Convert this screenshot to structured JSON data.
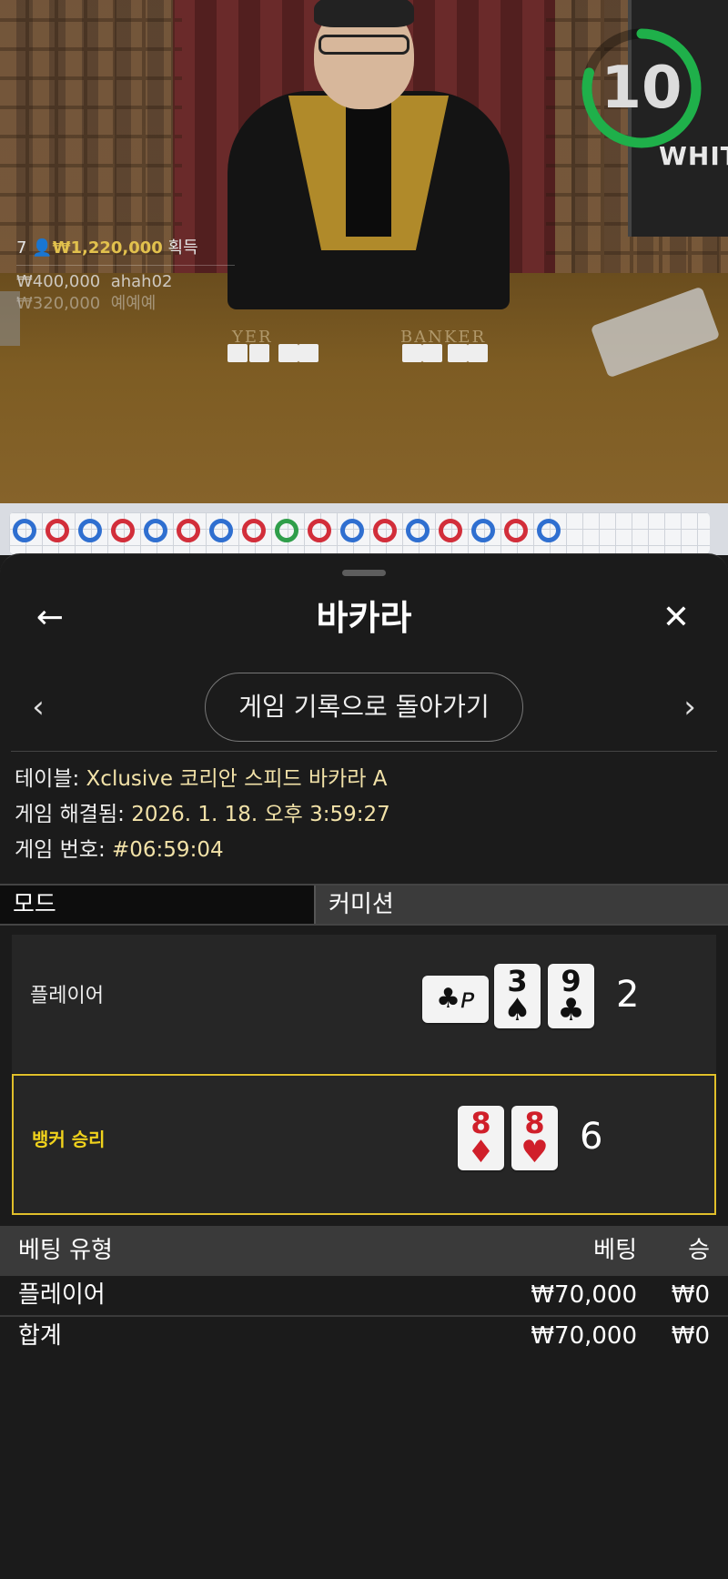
{
  "video": {
    "timer": "10",
    "monitor_text": "WHITE",
    "felt_labels": [
      "YER",
      "BANKER"
    ],
    "winners": {
      "count": "7",
      "total": "₩1,220,000",
      "total_suffix": "획득",
      "entries": [
        {
          "amount": "₩400,000",
          "name": "ahah02"
        },
        {
          "amount": "₩320,000",
          "name": "예예예"
        }
      ]
    }
  },
  "roadmap": {
    "beads": [
      "P",
      "B",
      "P",
      "B",
      "P",
      "B",
      "P",
      "B",
      "T",
      "B",
      "P",
      "B",
      "P",
      "B",
      "P",
      "B",
      "P"
    ]
  },
  "sheet": {
    "title": "바카라",
    "back_icon": "←",
    "close_icon": "✕",
    "prev_icon": "‹",
    "next_icon": "›",
    "back_to_history": "게임 기록으로 돌아가기",
    "info": {
      "table_label": "테이블:",
      "table_value": "Xclusive 코리안 스피드 바카라 A",
      "resolved_label": "게임 해결됨:",
      "resolved_value": "2026. 1. 18. 오후 3:59:27",
      "number_label": "게임 번호:",
      "number_value": "#06:59:04"
    },
    "mode_label": "모드",
    "mode_value": "커미션",
    "player": {
      "label": "플레이어",
      "score": "2",
      "third_card": {
        "rank": "♣",
        "suit": "ᴘ"
      },
      "cards": [
        {
          "rank": "3",
          "suit": "♠",
          "color": "#111111"
        },
        {
          "rank": "9",
          "suit": "♣",
          "color": "#111111"
        }
      ]
    },
    "banker": {
      "label": "뱅커 승리",
      "score": "6",
      "cards": [
        {
          "rank": "8",
          "suit": "♦",
          "color": "#d01f2a"
        },
        {
          "rank": "8",
          "suit": "♥",
          "color": "#d01f2a"
        }
      ]
    },
    "bets": {
      "headers": {
        "type": "베팅 유형",
        "bet": "베팅",
        "win": "승"
      },
      "rows": [
        {
          "type": "플레이어",
          "bet": "₩70,000",
          "win": "₩0"
        }
      ],
      "total": {
        "type": "합계",
        "bet": "₩70,000",
        "win": "₩0"
      }
    },
    "accent_color": "#e0bf2a"
  }
}
